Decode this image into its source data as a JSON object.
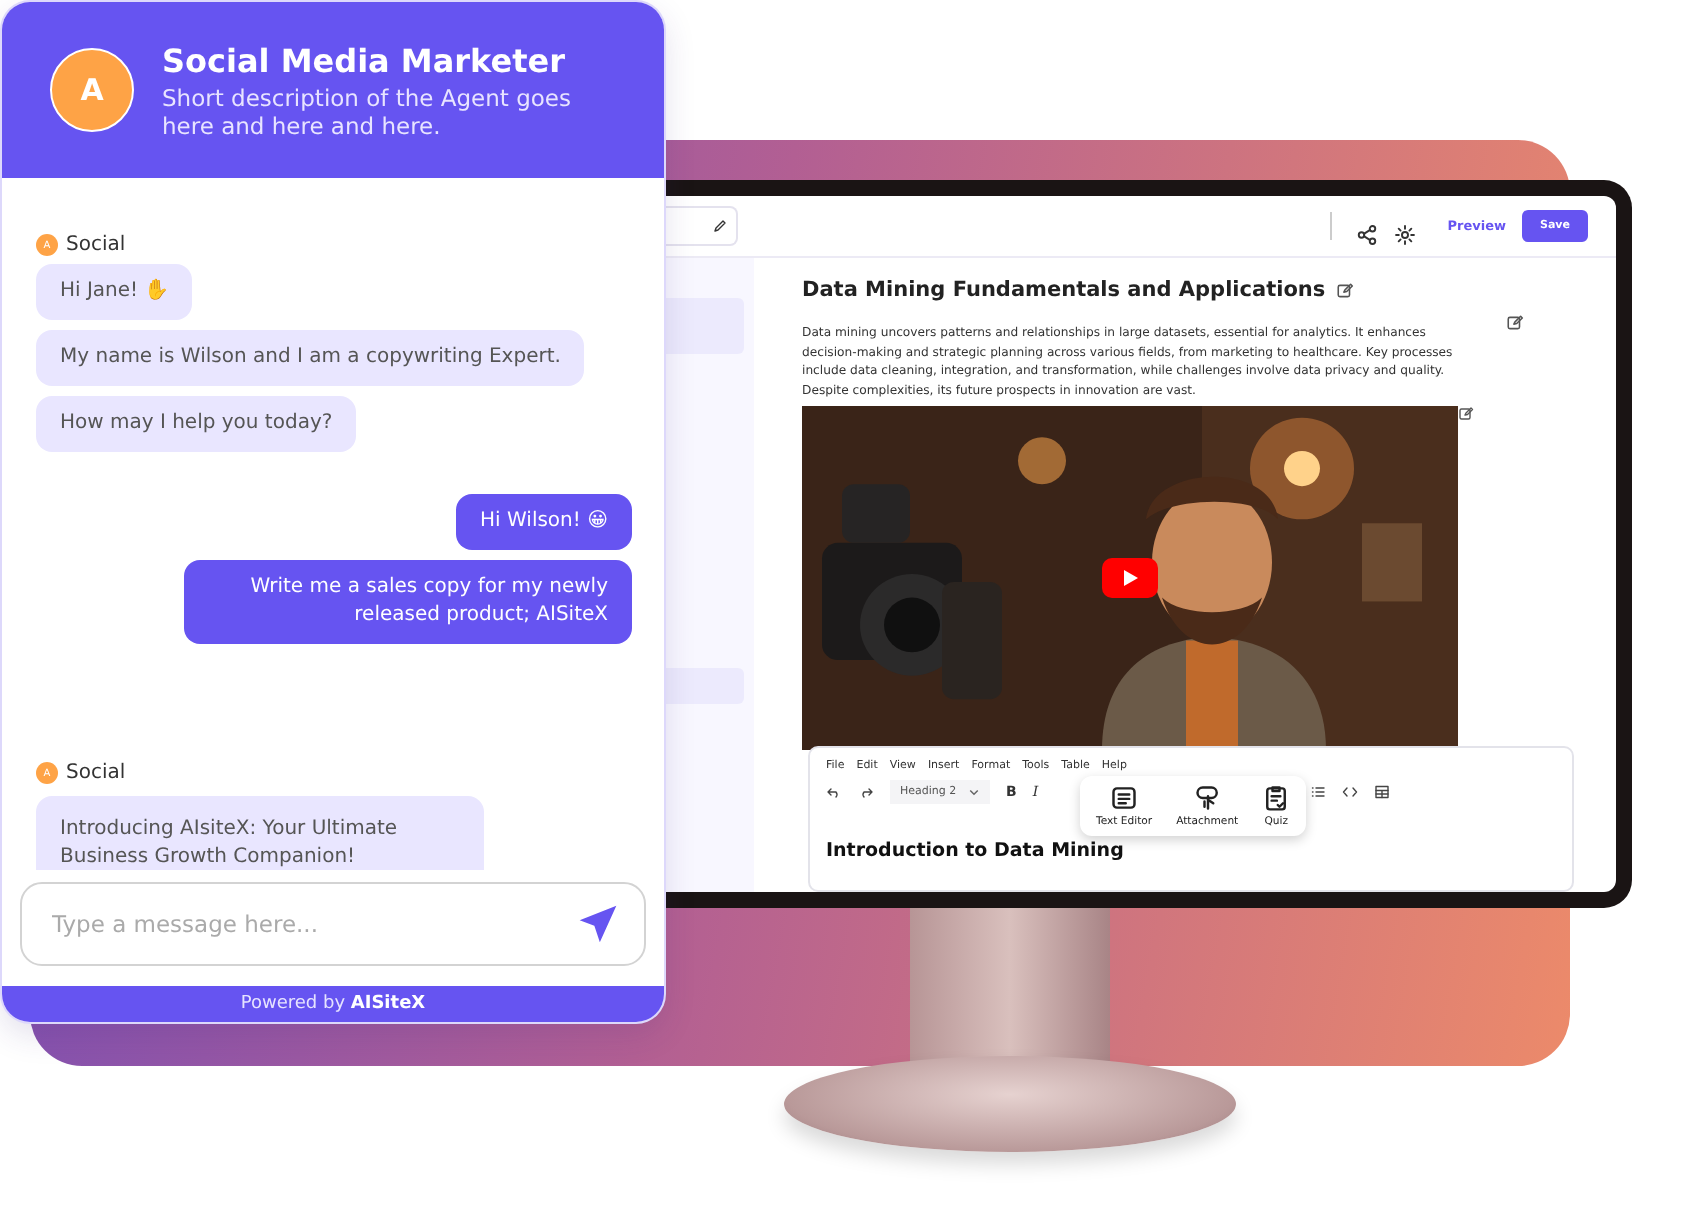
{
  "chat": {
    "avatar_letter": "A",
    "agent_name": "Social Media Marketer",
    "description": "Short description of the Agent goes here and here and here.",
    "messages": [
      {
        "kind": "sender",
        "avatar_letter": "A",
        "name": "Social"
      },
      {
        "kind": "agent",
        "text": "Hi Jane! ✋"
      },
      {
        "kind": "agent",
        "text": "My name is Wilson and I am a copywriting Expert."
      },
      {
        "kind": "agent",
        "text": "How may I help you today?"
      },
      {
        "kind": "user",
        "text": "Hi Wilson! 😀"
      },
      {
        "kind": "user",
        "text": "Write me a sales copy for my newly released product; AISiteX"
      },
      {
        "kind": "sender",
        "avatar_letter": "A",
        "name": "Social"
      },
      {
        "kind": "agent",
        "text": "Introducing AIsiteX: Your Ultimate Business Growth Companion!"
      }
    ],
    "input": {
      "placeholder": "Type a message here..."
    },
    "footer": "Powered by **AISiteX**"
  },
  "editor": {
    "preview": "Preview",
    "save": "Save",
    "title": "Data Mining Fundamentals and Applications",
    "summary": "Data mining uncovers patterns and relationships in large datasets, essential for analytics. It enhances decision-making and strategic planning across various fields, from marketing to healthcare. Key processes include data cleaning, integration, and transformation, while challenges involve data privacy and quality. Despite complexities, its future prospects in innovation are vast.",
    "menu": [
      "File",
      "Edit",
      "View",
      "Insert",
      "Format",
      "Tools",
      "Table",
      "Help"
    ],
    "block_format": "Heading 2",
    "bold": "B",
    "italic": "I",
    "insert_menu": [
      {
        "kind": "text",
        "label": "Text Editor"
      },
      {
        "kind": "attachment",
        "label": "Attachment"
      },
      {
        "kind": "quiz",
        "label": "Quiz"
      }
    ],
    "content_heading": "Introduction to Data Mining"
  }
}
